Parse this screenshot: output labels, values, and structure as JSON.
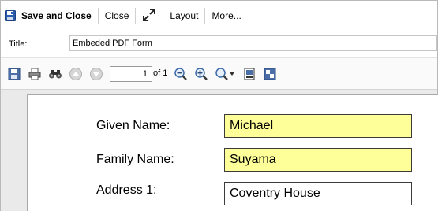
{
  "toolbar": {
    "save_close_label": "Save and Close",
    "close_label": "Close",
    "layout_label": "Layout",
    "more_label": "More..."
  },
  "title_row": {
    "label": "Title:",
    "value": "Embeded PDF Form"
  },
  "pdf_toolbar": {
    "page_value": "1",
    "of_label": "of 1"
  },
  "form": {
    "fields": [
      {
        "label": "Given Name:",
        "value": "Michael"
      },
      {
        "label": "Family Name:",
        "value": "Suyama"
      },
      {
        "label": "Address 1:",
        "value": "Coventry House"
      }
    ]
  },
  "colors": {
    "field_highlight": "#ffff99",
    "save_icon": "#2a5db0"
  }
}
